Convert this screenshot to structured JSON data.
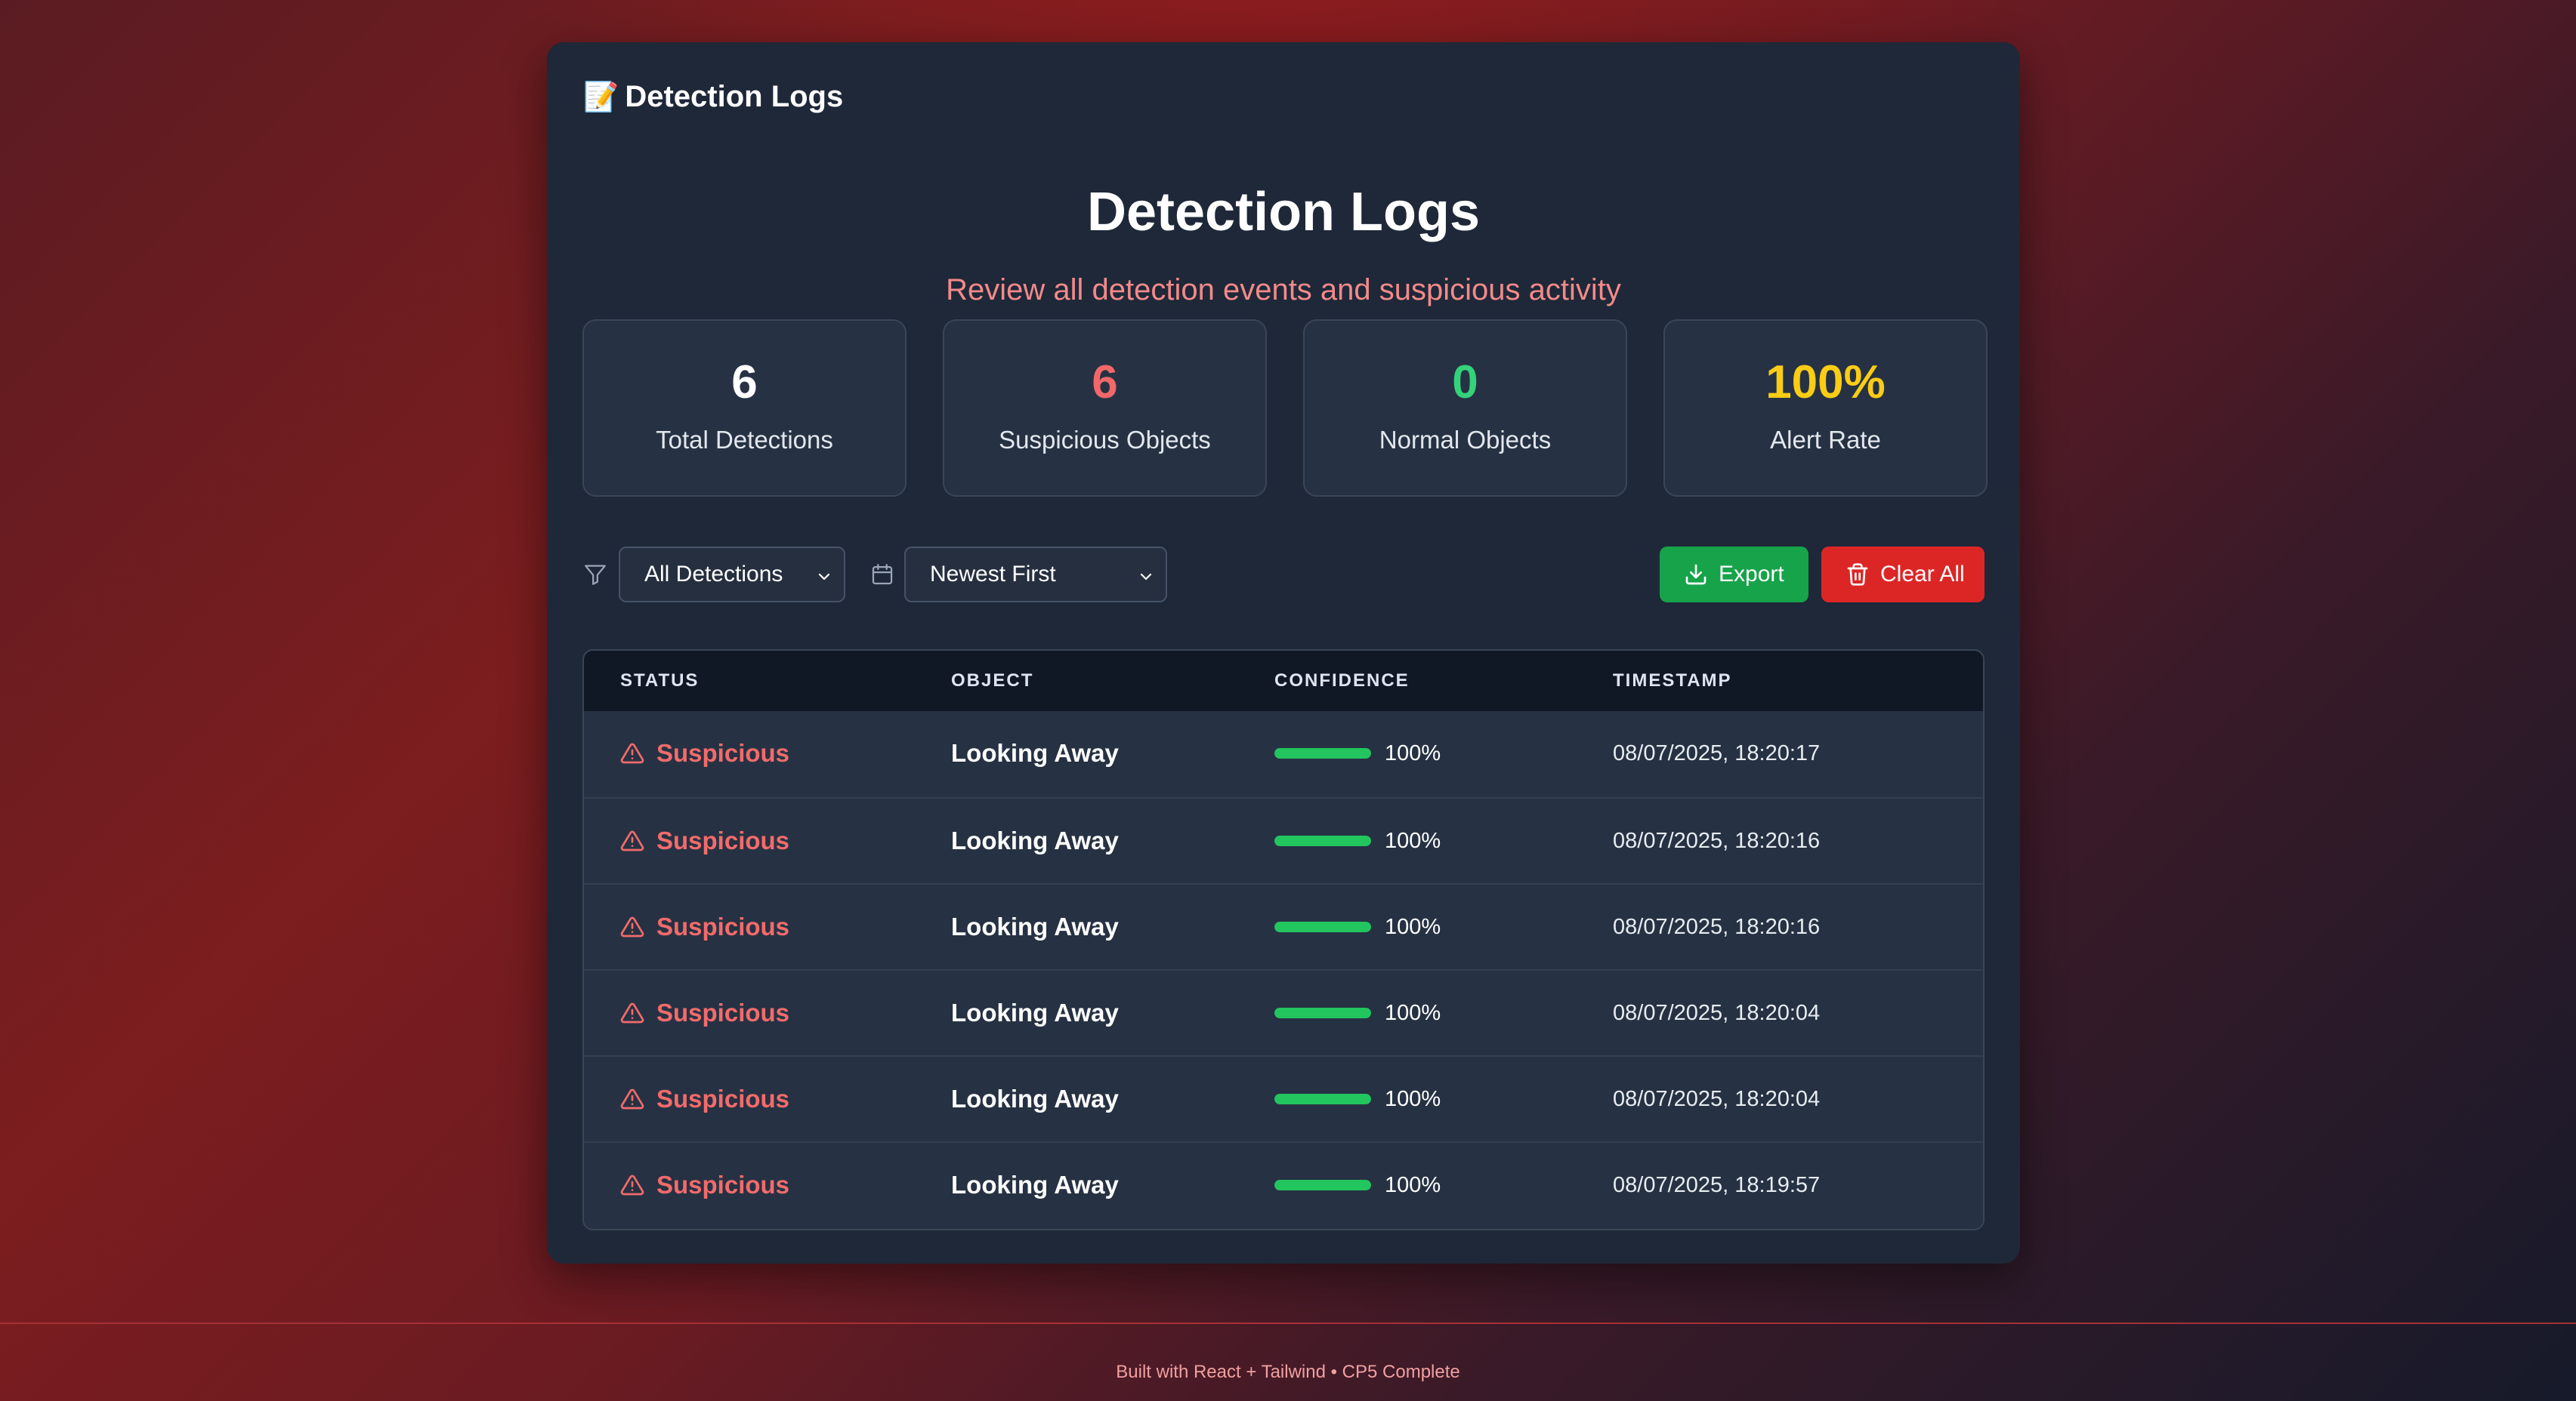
{
  "panel": {
    "header_emoji": "📝",
    "header": "Detection Logs"
  },
  "title": "Detection Logs",
  "subtitle": "Review all detection events and suspicious activity",
  "stats": [
    {
      "value": "6",
      "label": "Total Detections",
      "color": "#ffffff"
    },
    {
      "value": "6",
      "label": "Suspicious Objects",
      "color": "#f26868"
    },
    {
      "value": "0",
      "label": "Normal Objects",
      "color": "#34d27a"
    },
    {
      "value": "100%",
      "label": "Alert Rate",
      "color": "#facc15"
    }
  ],
  "controls": {
    "filter_value": "All Detections",
    "sort_value": "Newest First",
    "export_label": "Export",
    "clear_label": "Clear All"
  },
  "table": {
    "headers": {
      "status": "STATUS",
      "object": "OBJECT",
      "confidence": "CONFIDENCE",
      "timestamp": "TIMESTAMP"
    },
    "rows": [
      {
        "status": "Suspicious",
        "object": "Looking Away",
        "confidence": "100%",
        "confidence_fraction": 1.0,
        "timestamp": "08/07/2025, 18:20:17"
      },
      {
        "status": "Suspicious",
        "object": "Looking Away",
        "confidence": "100%",
        "confidence_fraction": 1.0,
        "timestamp": "08/07/2025, 18:20:16"
      },
      {
        "status": "Suspicious",
        "object": "Looking Away",
        "confidence": "100%",
        "confidence_fraction": 1.0,
        "timestamp": "08/07/2025, 18:20:16"
      },
      {
        "status": "Suspicious",
        "object": "Looking Away",
        "confidence": "100%",
        "confidence_fraction": 1.0,
        "timestamp": "08/07/2025, 18:20:04"
      },
      {
        "status": "Suspicious",
        "object": "Looking Away",
        "confidence": "100%",
        "confidence_fraction": 1.0,
        "timestamp": "08/07/2025, 18:20:04"
      },
      {
        "status": "Suspicious",
        "object": "Looking Away",
        "confidence": "100%",
        "confidence_fraction": 1.0,
        "timestamp": "08/07/2025, 18:19:57"
      }
    ]
  },
  "footer": "Built with React + Tailwind • CP5 Complete"
}
